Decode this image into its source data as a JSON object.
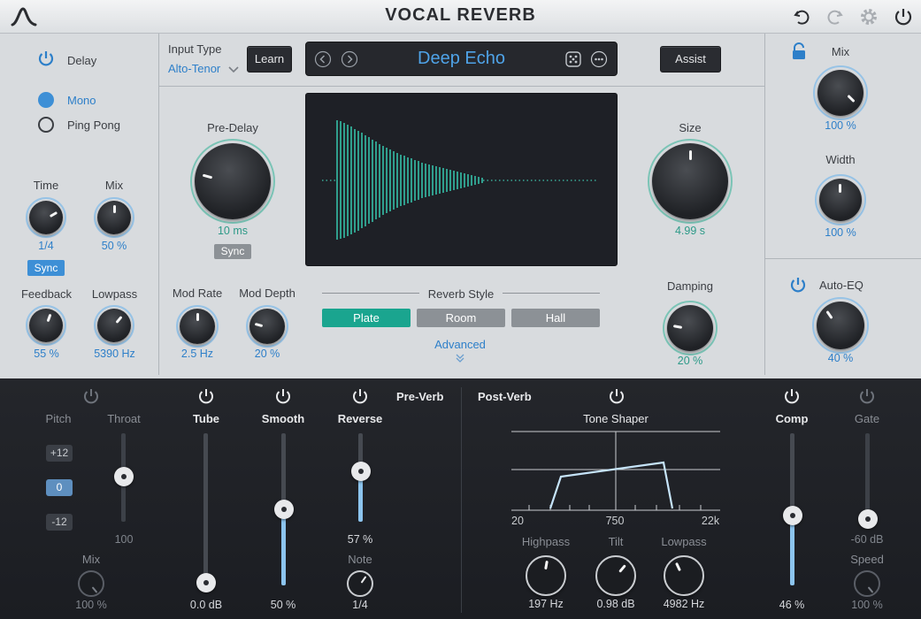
{
  "header": {
    "title": "VOCAL REVERB",
    "icons": [
      "logo-icon",
      "undo-icon",
      "redo-icon",
      "settings-icon",
      "power-icon"
    ]
  },
  "delay": {
    "label": "Delay",
    "modes": [
      {
        "label": "Mono",
        "selected": true
      },
      {
        "label": "Ping Pong",
        "selected": false
      }
    ],
    "time": {
      "label": "Time",
      "value": "1/4"
    },
    "mix": {
      "label": "Mix",
      "value": "50 %"
    },
    "sync_label": "Sync",
    "feedback": {
      "label": "Feedback",
      "value": "55 %"
    },
    "lowpass": {
      "label": "Lowpass",
      "value": "5390 Hz"
    }
  },
  "input": {
    "label": "Input Type",
    "value": "Alto-Tenor",
    "learn": "Learn"
  },
  "preset": {
    "name": "Deep Echo",
    "assist": "Assist"
  },
  "predelay": {
    "label": "Pre-Delay",
    "value": "10 ms",
    "sync": "Sync"
  },
  "size": {
    "label": "Size",
    "value": "4.99 s"
  },
  "damping": {
    "label": "Damping",
    "value": "20 %"
  },
  "modrate": {
    "label": "Mod Rate",
    "value": "2.5 Hz"
  },
  "moddepth": {
    "label": "Mod Depth",
    "value": "20 %"
  },
  "reverb_style": {
    "label": "Reverb Style",
    "options": [
      "Plate",
      "Room",
      "Hall"
    ],
    "selected": "Plate",
    "advanced": "Advanced"
  },
  "right": {
    "mix": {
      "label": "Mix",
      "value": "100 %"
    },
    "width": {
      "label": "Width",
      "value": "100 %"
    },
    "autoeq": {
      "label": "Auto-EQ",
      "value": "40 %"
    }
  },
  "preverb": {
    "label": "Pre-Verb",
    "pitch": {
      "label": "Pitch",
      "options": [
        "+12",
        "0",
        "-12"
      ],
      "selected": "0"
    },
    "throat": {
      "label": "Throat",
      "value": "100"
    },
    "mix": {
      "label": "Mix",
      "value": "100 %"
    },
    "tube": {
      "label": "Tube",
      "value": "0.0 dB"
    },
    "smooth": {
      "label": "Smooth",
      "value": "50 %"
    },
    "reverse": {
      "label": "Reverse",
      "value": "57 %",
      "note_label": "Note",
      "note_value": "1/4"
    }
  },
  "postverb": {
    "label": "Post-Verb",
    "tone_shaper": {
      "label": "Tone Shaper",
      "axis": [
        "20",
        "750",
        "22k"
      ]
    },
    "highpass": {
      "label": "Highpass",
      "value": "197 Hz"
    },
    "tilt": {
      "label": "Tilt",
      "value": "0.98 dB"
    },
    "lowpass": {
      "label": "Lowpass",
      "value": "4982 Hz"
    },
    "comp": {
      "label": "Comp",
      "value": "46 %"
    },
    "gate": {
      "label": "Gate",
      "value": "-60 dB",
      "speed_label": "Speed",
      "speed_value": "100 %"
    }
  },
  "colors": {
    "accent_blue": "#2d7fc9",
    "accent_teal": "#2d9a88",
    "plate_selected": "#1aa58f"
  }
}
